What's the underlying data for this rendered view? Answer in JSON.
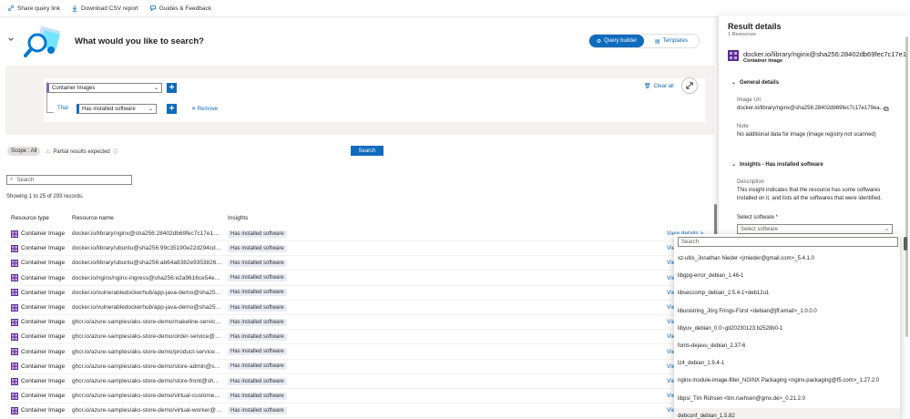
{
  "toolbar": {
    "share": "Share query link",
    "download": "Download CSV report",
    "guides": "Guides & Feedback"
  },
  "header": {
    "question": "What would you like to search?",
    "toggle": [
      "Query builder",
      "Templates"
    ]
  },
  "query": {
    "entity": "Container Images",
    "that_label": "That",
    "condition": "Has installed software",
    "remove": "Remove",
    "clear_all": "Clear all"
  },
  "scope": {
    "label": "Scope : All",
    "partial": "Partial results expected",
    "search_button": "Search",
    "search_placeholder": "Search",
    "showing": "Showing 1 to 25 of 293 records."
  },
  "table": {
    "headers": [
      "Resource type",
      "Resource name",
      "Insights"
    ],
    "rows": [
      {
        "type": "Container Image",
        "name": "docker.io/library/nginx@sha256:28402db69fec7c17e179ea...",
        "insight": "Has installed software",
        "view": "View details >"
      },
      {
        "type": "Container Image",
        "name": "docker.io/library/ubuntu@sha256:99c35190e22d294cdace2...",
        "insight": "Has installed software",
        "view": "View details >"
      },
      {
        "type": "Container Image",
        "name": "docker.io/library/ubuntu@sha256:ab64a8382e935382638 7...",
        "insight": "Has installed software",
        "view": "View details >"
      },
      {
        "type": "Container Image",
        "name": "docker.io/nginx/nginx-ingress@sha256:e2a9616ce54e2dbb...",
        "insight": "Has installed software",
        "view": "View details >"
      },
      {
        "type": "Container Image",
        "name": "docker.io/vulnerabledockerhub/app-java-demo@sha256:c8...",
        "insight": "Has installed software",
        "view": "View details >"
      },
      {
        "type": "Container Image",
        "name": "docker.io/vulnerabledockerhub/app-java-demo@sha256:e...",
        "insight": "Has installed software",
        "view": "View details >"
      },
      {
        "type": "Container Image",
        "name": "ghcr.io/azure-samples/aks-store-demo/makeline-service@...",
        "insight": "Has installed software",
        "view": "View details >"
      },
      {
        "type": "Container Image",
        "name": "ghcr.io/azure-samples/aks-store-demo/order-service@sha...",
        "insight": "Has installed software",
        "view": "View details >"
      },
      {
        "type": "Container Image",
        "name": "ghcr.io/azure-samples/aks-store-demo/product-service@s...",
        "insight": "Has installed software",
        "view": "View details >"
      },
      {
        "type": "Container Image",
        "name": "ghcr.io/azure-samples/aks-store-demo/store-admin@sha2...",
        "insight": "Has installed software",
        "view": "View details >"
      },
      {
        "type": "Container Image",
        "name": "ghcr.io/azure-samples/aks-store-demo/store-front@sha25...",
        "insight": "Has installed software",
        "view": "View details >"
      },
      {
        "type": "Container Image",
        "name": "ghcr.io/azure-samples/aks-store-demo/virtual-customer@s...",
        "insight": "Has installed software",
        "view": "View details >"
      },
      {
        "type": "Container Image",
        "name": "ghcr.io/azure-samples/aks-store-demo/virtual-worker@sha...",
        "insight": "Has installed software",
        "view": "View details >"
      }
    ]
  },
  "panel": {
    "title": "Result details",
    "subtitle": "1 Resources",
    "resource_name": "docker.io/library/nginx@sha256:28402db69fec7c17e1",
    "resource_type": "Container Image",
    "general_head": "General details",
    "image_uri_label": "Image Uri",
    "image_uri_value": "docker.io/library/nginx@sha256:28402db69fec7c17e179ea...",
    "note_label": "Note",
    "note_value": "No additional data for image (image registry not scanned)",
    "insights_head": "Insights - Has installed software",
    "desc_label": "Description",
    "desc_value": "This insight indicates that the resource has some softwares installed on it, and lists all the softwares that were identified.",
    "select_label": "Select software *",
    "select_placeholder": "Select software",
    "dd_search": "Search",
    "dd_items": [
      "xz-utils_Jonathan Nieder <jrnieder@gmail.com>_5.4.1.0",
      "libgpg-error_debian_1.46-1",
      "libseccomp_debian_2.5.4-1+deb12u1",
      "libunistring_Jörg Frings-Fürst <debian@jff.email>_1.0.0.0",
      "libyuv_debian_0.0~git20230123.b2528b0-1",
      "fonts-dejavu_debian_2.37-6",
      "lz4_debian_1.9.4-1",
      "nginx-module-image-filter_NGINX Packaging <nginx-packaging@f5.com>_1.27.2.0",
      "libpsl_Tim Rühsen <tim.ruehsen@gmx.de>_0.21.2.0",
      "debconf_debian_1.5.82"
    ]
  },
  "colors": {
    "accent": "#0f6cbd",
    "chip": "#e8ecf5",
    "purple": "#8764b8"
  }
}
